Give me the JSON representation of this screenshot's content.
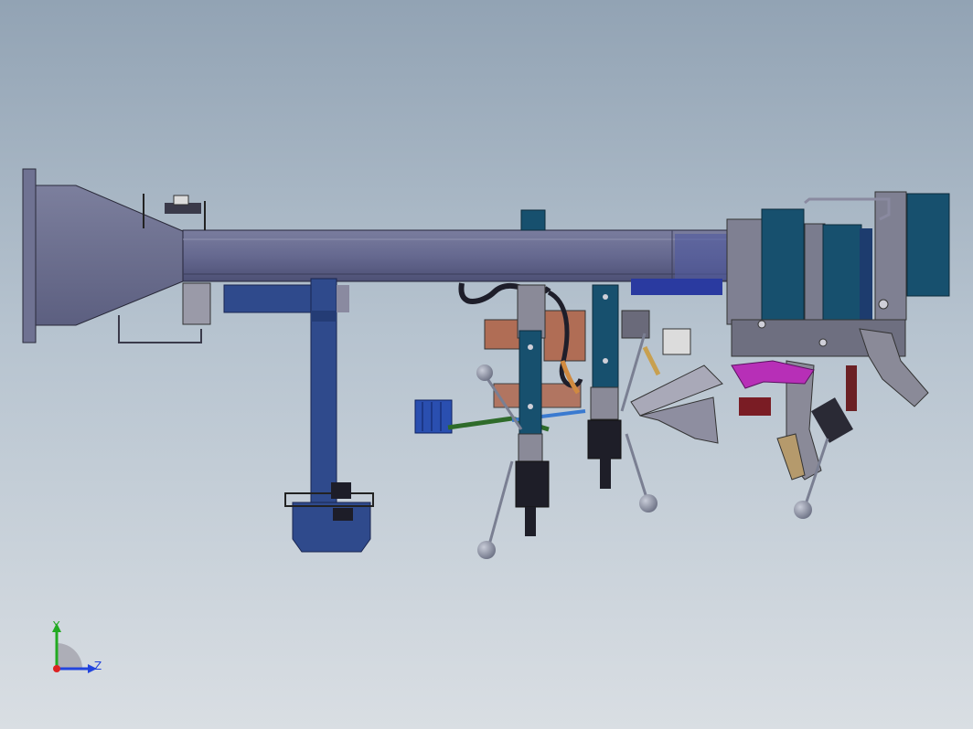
{
  "viewport": {
    "background_top": "#92a3b4",
    "background_bottom": "#d9dee3"
  },
  "model": {
    "description_icon": "cad-assembly-fixture",
    "colors": {
      "beam": "#6c6f92",
      "beam_dark": "#4b4e6e",
      "column": "#2f4a8c",
      "column_dark": "#1f3366",
      "panel_teal": "#17506e",
      "clamp_gray": "#8a8a98",
      "copper": "#b06d55",
      "magenta": "#b72fb7",
      "tan": "#b59a6c",
      "hose": "#1e1e2a",
      "green": "#2e6b2a",
      "sphere": "#8f95a6"
    }
  },
  "triad": {
    "y_label": "Y",
    "z_label": "Z",
    "y_color": "#22aa22",
    "z_color": "#2244dd",
    "x_color": "#dd2222"
  }
}
